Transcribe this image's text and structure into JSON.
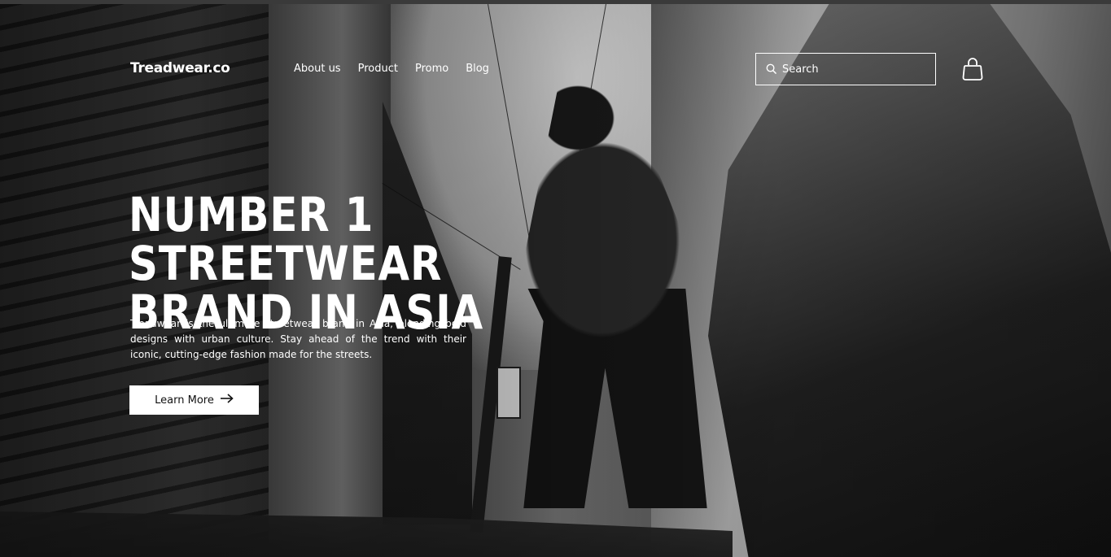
{
  "header": {
    "logo": "Treadwear.co",
    "nav": [
      {
        "label": "About us"
      },
      {
        "label": "Product"
      },
      {
        "label": "Promo"
      },
      {
        "label": "Blog"
      }
    ],
    "search": {
      "placeholder": "Search",
      "icon": "search-icon"
    },
    "cart": {
      "icon": "shopping-bag-icon"
    }
  },
  "hero": {
    "headline_line1": "NUMBER 1 STREETWEAR",
    "headline_line2": "BRAND IN ASIA",
    "description": "Treadwear is the ultimate streetwear brand in Asia, blending bold designs with urban culture. Stay ahead of the trend with their iconic, cutting-edge fashion made for the streets.",
    "cta": {
      "label": "Learn More",
      "icon": "arrow-right-icon"
    }
  },
  "colors": {
    "text": "#ffffff",
    "button_bg": "#ffffff",
    "button_text": "#111111"
  }
}
